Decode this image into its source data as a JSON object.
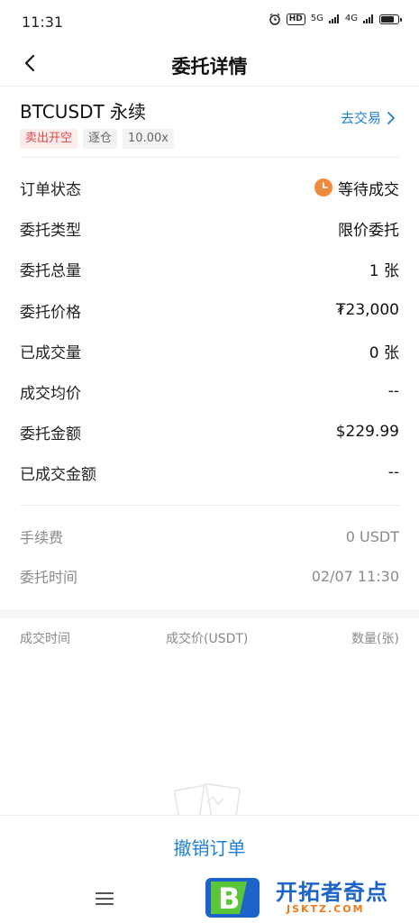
{
  "status_bar": {
    "time": "11:31",
    "hd": "HD",
    "net_5g": "5G",
    "net_4g": "4G"
  },
  "nav": {
    "title": "委托详情"
  },
  "contract": {
    "name": "BTCUSDT 永续",
    "side_tag": "卖出开空",
    "margin_tag": "逐仓",
    "leverage_tag": "10.00x",
    "trade_link": "去交易"
  },
  "details": [
    {
      "label": "订单状态",
      "value": "等待成交"
    },
    {
      "label": "委托类型",
      "value": "限价委托"
    },
    {
      "label": "委托总量",
      "value": "1 张"
    },
    {
      "label": "委托价格",
      "value": "₮23,000"
    },
    {
      "label": "已成交量",
      "value": "0 张"
    },
    {
      "label": "成交均价",
      "value": "--"
    },
    {
      "label": "委托金额",
      "value": "$229.99"
    },
    {
      "label": "已成交金额",
      "value": "--"
    }
  ],
  "extra": [
    {
      "label": "手续费",
      "value": "0 USDT"
    },
    {
      "label": "委托时间",
      "value": "02/07 11:30"
    }
  ],
  "fills_table": {
    "columns": [
      "成交时间",
      "成交价(USDT)",
      "数量(张)"
    ]
  },
  "actions": {
    "cancel_order": "撤销订单"
  },
  "watermark": {
    "title": "开拓者奇点",
    "sub": "JSKTZ.COM"
  },
  "colors": {
    "accent": "#1f7fd6",
    "sell": "#e04848",
    "pending": "#f08a3c"
  }
}
